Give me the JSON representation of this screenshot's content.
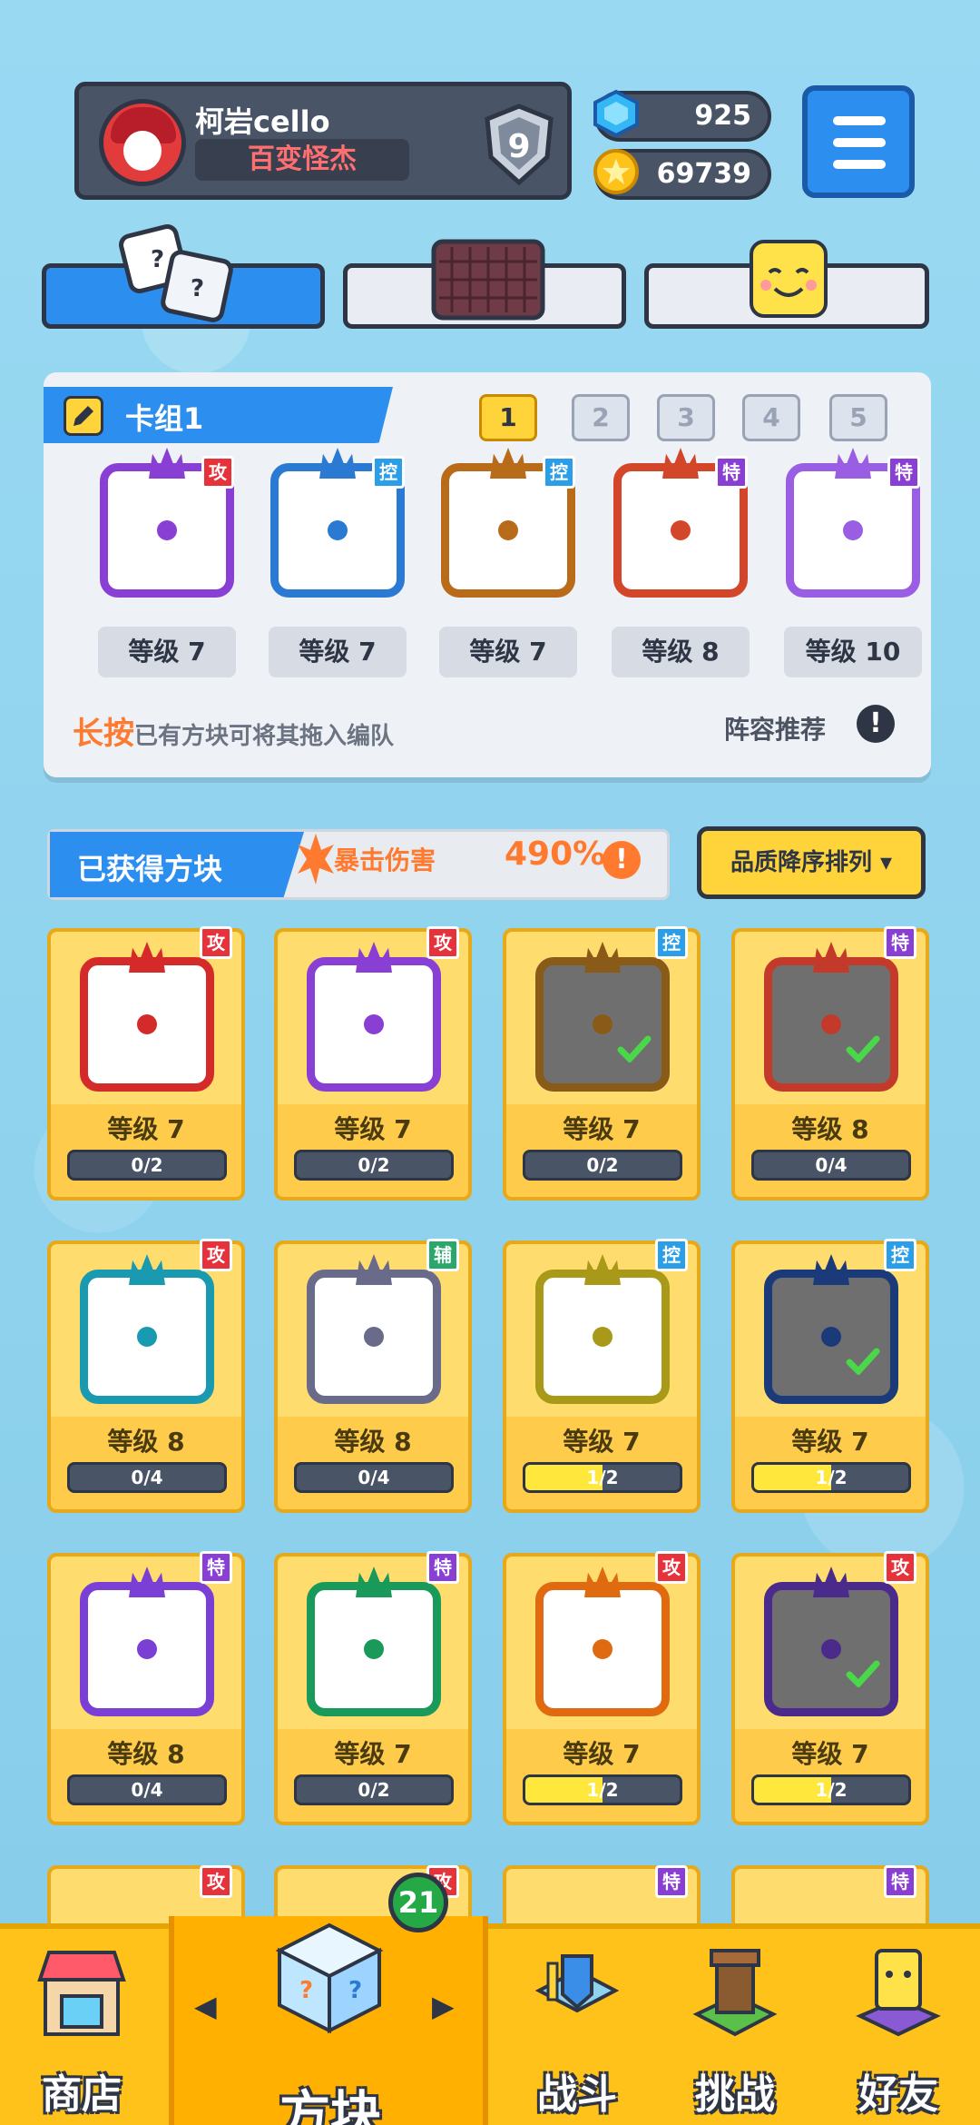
{
  "player": {
    "name": "柯岩cello",
    "title": "百变怪杰",
    "rank": "9"
  },
  "currency": {
    "gems": "925",
    "coins": "69739"
  },
  "deck": {
    "title": "卡组1",
    "slots": [
      "1",
      "2",
      "3",
      "4",
      "5"
    ],
    "active_slot": "1",
    "blocks": [
      {
        "tag": "攻",
        "level": "等级 7",
        "color": "#8a3fd4"
      },
      {
        "tag": "控",
        "level": "等级 7",
        "color": "#2a7ad4"
      },
      {
        "tag": "控",
        "level": "等级 7",
        "color": "#b86b18"
      },
      {
        "tag": "特",
        "level": "等级 8",
        "color": "#d4462a"
      },
      {
        "tag": "特",
        "level": "等级 10",
        "color": "#9a5ee4"
      }
    ],
    "hint_emph": "长按",
    "hint_text": "已有方块可将其拖入编队",
    "recommend": "阵容推荐"
  },
  "owned": {
    "title": "已获得方块",
    "crit_label": "暴击伤害",
    "crit_value": "490%",
    "sort_label": "品质降序排列 ▾",
    "cards": [
      {
        "tag": "攻",
        "level": "等级 7",
        "progress": "0/2",
        "fill": 0,
        "color": "#d42a2a",
        "dark": false,
        "check": false
      },
      {
        "tag": "攻",
        "level": "等级 7",
        "progress": "0/2",
        "fill": 0,
        "color": "#8a3fd4",
        "dark": false,
        "check": false
      },
      {
        "tag": "控",
        "level": "等级 7",
        "progress": "0/2",
        "fill": 0,
        "color": "#8a5a18",
        "dark": true,
        "check": true
      },
      {
        "tag": "特",
        "level": "等级 8",
        "progress": "0/4",
        "fill": 0,
        "color": "#c43a2a",
        "dark": true,
        "check": true
      },
      {
        "tag": "攻",
        "level": "等级 8",
        "progress": "0/4",
        "fill": 0,
        "color": "#1a9ab0",
        "dark": false,
        "check": false
      },
      {
        "tag": "辅",
        "level": "等级 8",
        "progress": "0/4",
        "fill": 0,
        "color": "#6a6a8a",
        "dark": false,
        "check": false
      },
      {
        "tag": "控",
        "level": "等级 7",
        "progress": "1/2",
        "fill": 0.5,
        "color": "#a89a18",
        "dark": false,
        "check": false
      },
      {
        "tag": "控",
        "level": "等级 7",
        "progress": "1/2",
        "fill": 0.5,
        "color": "#1a3a7a",
        "dark": true,
        "check": true
      },
      {
        "tag": "特",
        "level": "等级 8",
        "progress": "0/4",
        "fill": 0,
        "color": "#7a3fd4",
        "dark": false,
        "check": false
      },
      {
        "tag": "特",
        "level": "等级 7",
        "progress": "0/2",
        "fill": 0,
        "color": "#1a9a5a",
        "dark": false,
        "check": false
      },
      {
        "tag": "攻",
        "level": "等级 7",
        "progress": "1/2",
        "fill": 0.5,
        "color": "#e06a10",
        "dark": false,
        "check": false
      },
      {
        "tag": "攻",
        "level": "等级 7",
        "progress": "1/2",
        "fill": 0.5,
        "color": "#4a2a8a",
        "dark": true,
        "check": true
      }
    ],
    "partial_tags": [
      "攻",
      "攻",
      "特",
      "特"
    ]
  },
  "nav": {
    "shop": "商店",
    "blocks": "方块",
    "battle": "战斗",
    "challenge": "挑战",
    "friends": "好友",
    "blocks_badge": "21"
  }
}
